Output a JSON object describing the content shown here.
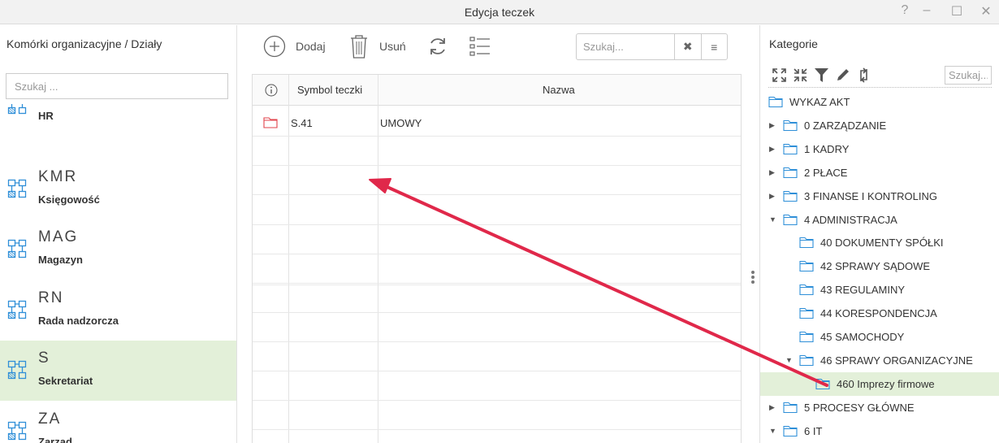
{
  "window": {
    "title": "Edycja teczek",
    "controls": [
      "?",
      "–",
      "☐",
      "✕"
    ]
  },
  "left_panel": {
    "header": "Komórki organizacyjne / Działy",
    "search_placeholder": "Szukaj ...",
    "departments": [
      {
        "code": "",
        "name": "HR",
        "selected": false
      },
      {
        "code": "KMR",
        "name": "Księgowość",
        "selected": false
      },
      {
        "code": "MAG",
        "name": "Magazyn",
        "selected": false
      },
      {
        "code": "RN",
        "name": "Rada nadzorcza",
        "selected": false
      },
      {
        "code": "S",
        "name": "Sekretariat",
        "selected": true
      },
      {
        "code": "ZA",
        "name": "Zarząd",
        "selected": false
      }
    ]
  },
  "toolbar": {
    "add_label": "Dodaj",
    "delete_label": "Usuń",
    "search_placeholder": "Szukaj..."
  },
  "grid": {
    "columns": [
      "",
      "Symbol teczki",
      "Nazwa"
    ],
    "rows": [
      {
        "symbol": "S.41",
        "name": "UMOWY"
      }
    ]
  },
  "right_panel": {
    "header": "Kategorie",
    "search_placeholder": "Szukaj...",
    "tree": [
      {
        "label": "WYKAZ AKT",
        "level": 0,
        "expander": "none"
      },
      {
        "label": "0 ZARZĄDZANIE",
        "level": 1,
        "expander": "collapsed"
      },
      {
        "label": "1 KADRY",
        "level": 1,
        "expander": "collapsed"
      },
      {
        "label": "2 PŁACE",
        "level": 1,
        "expander": "collapsed"
      },
      {
        "label": "3 FINANSE I KONTROLING",
        "level": 1,
        "expander": "collapsed"
      },
      {
        "label": "4 ADMINISTRACJA",
        "level": 1,
        "expander": "expanded"
      },
      {
        "label": "40 DOKUMENTY SPÓŁKI",
        "level": 2,
        "expander": "none"
      },
      {
        "label": "42 SPRAWY SĄDOWE",
        "level": 2,
        "expander": "none"
      },
      {
        "label": "43 REGULAMINY",
        "level": 2,
        "expander": "none"
      },
      {
        "label": "44 KORESPONDENCJA",
        "level": 2,
        "expander": "none"
      },
      {
        "label": "45 SAMOCHODY",
        "level": 2,
        "expander": "none"
      },
      {
        "label": "46 SPRAWY ORGANIZACYJNE",
        "level": 2,
        "expander": "expanded"
      },
      {
        "label": "460 Imprezy firmowe",
        "level": 3,
        "expander": "none",
        "selected": true
      },
      {
        "label": "5 PROCESY GŁÓWNE",
        "level": 1,
        "expander": "collapsed"
      },
      {
        "label": "6 IT",
        "level": 1,
        "expander": "expanded"
      }
    ]
  },
  "colors": {
    "selection": "#e3f0d9",
    "folder_blue": "#2f8fd8",
    "folder_red": "#e2434b",
    "annotation_arrow": "#e0284a"
  },
  "icons": {
    "department": "org-chart-icon",
    "add": "plus-circle-icon",
    "delete": "trash-icon",
    "refresh": "refresh-icon",
    "list": "checklist-icon",
    "clear": "clear-x-icon",
    "menu": "hamburger-icon",
    "expand_all": "expand-all-icon",
    "collapse_all": "collapse-all-icon",
    "filter": "filter-icon",
    "edit": "pencil-icon",
    "sync": "sync-icon",
    "folder": "folder-icon"
  }
}
